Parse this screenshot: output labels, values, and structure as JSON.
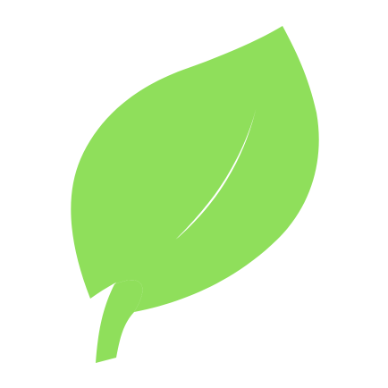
{
  "icon": {
    "name": "leaf-icon",
    "color": "#8fdf5b",
    "background": "#ffffff"
  }
}
